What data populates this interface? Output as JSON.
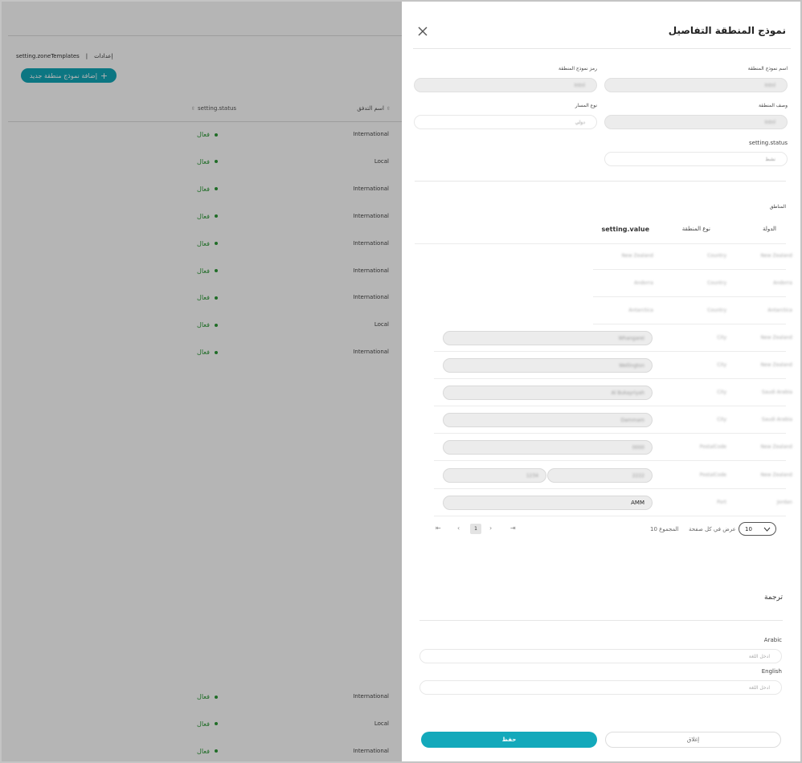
{
  "background": {
    "breadcrumb": {
      "section": "إعدادات",
      "separator": "|",
      "page": "setting.zoneTemplates"
    },
    "add_button": {
      "icon": "plus-icon",
      "label": "إضافة نموذج منطقة جديد"
    },
    "columns": {
      "type": "اسم التدفق",
      "status": "setting.status"
    },
    "rows": [
      {
        "type": "International",
        "status": "فعال"
      },
      {
        "type": "Local",
        "status": "فعال"
      },
      {
        "type": "International",
        "status": "فعال"
      },
      {
        "type": "International",
        "status": "فعال"
      },
      {
        "type": "International",
        "status": "فعال"
      },
      {
        "type": "International",
        "status": "فعال"
      },
      {
        "type": "International",
        "status": "فعال"
      },
      {
        "type": "Local",
        "status": "فعال"
      },
      {
        "type": "International",
        "status": "فعال"
      }
    ],
    "bottom_rows": [
      {
        "type": "International",
        "status": "فعال"
      },
      {
        "type": "Local",
        "status": "فعال"
      },
      {
        "type": "International",
        "status": "فعال"
      }
    ],
    "status_color": "#2e9a38",
    "accent": "#12a6b8"
  },
  "drawer": {
    "title": "نموذج المنطقة التفاصيل",
    "close_icon": "close-icon",
    "fields": {
      "name": {
        "label": "اسم نموذج المنطقة",
        "value": "Intnl"
      },
      "code": {
        "label": "رمز نموذج المنطقة",
        "value": "Intnl"
      },
      "description": {
        "label": "وصف المنطقة",
        "value": "Intnl"
      },
      "route_type": {
        "label": "نوع المسار",
        "value": "دولي"
      },
      "status": {
        "label": "setting.status",
        "value": "نشط"
      }
    },
    "regions": {
      "section_label": "المناطق",
      "columns": {
        "country": "الدولة",
        "zone_type": "نوع المنطقة",
        "value": "setting.value"
      },
      "rows": [
        {
          "country": "New Zealand",
          "type": "Country",
          "value": "New Zealand",
          "inputs": []
        },
        {
          "country": "Andorra",
          "type": "Country",
          "value": "Andorra",
          "inputs": []
        },
        {
          "country": "Antarctica",
          "type": "Country",
          "value": "Antarctica",
          "inputs": []
        },
        {
          "country": "New Zealand",
          "type": "City",
          "value": "",
          "inputs": [
            "Whangarei"
          ]
        },
        {
          "country": "New Zealand",
          "type": "City",
          "value": "",
          "inputs": [
            "Wellington"
          ]
        },
        {
          "country": "Saudi Arabia",
          "type": "City",
          "value": "Al Bukayriyah",
          "inputs": [
            "Al Bukayriyah"
          ]
        },
        {
          "country": "Saudi Arabia",
          "type": "City",
          "value": "",
          "inputs": [
            "Dammam"
          ]
        },
        {
          "country": "New Zealand",
          "type": "PostalCode",
          "value": "",
          "inputs": [
            "0000"
          ]
        },
        {
          "country": "New Zealand",
          "type": "PostalCode",
          "value": "",
          "inputs": [
            "2222",
            "1234"
          ]
        },
        {
          "country": "Jordan",
          "type": "Port",
          "value": "",
          "inputs": [
            "AMM"
          ]
        }
      ],
      "pagination": {
        "current": "1",
        "total_label": "المجموع 10",
        "per_page_label": "عرض في كل صفحة",
        "per_page": "10"
      }
    },
    "translation": {
      "heading": "ترجمة",
      "arabic": {
        "label": "Arabic",
        "placeholder": "ادخل اللغة"
      },
      "english": {
        "label": "English",
        "placeholder": "ادخل اللغة"
      }
    },
    "footer": {
      "cancel": "إغلاق",
      "save": "حفظ"
    }
  }
}
